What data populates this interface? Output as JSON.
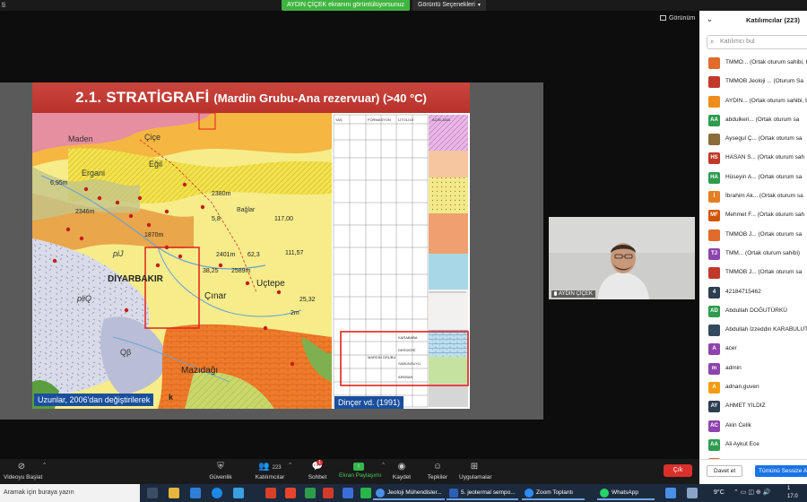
{
  "topbar": {
    "left_mark": "ti",
    "share_banner": "AYDIN ÇİÇEK ekranını görüntülüyorsunuz",
    "view_options": "Görüntü Seçenekleri"
  },
  "stage": {
    "view_button": "Görünüm"
  },
  "slide": {
    "title": "2.1. STRATİGRAFİ",
    "subtitle": "(Mardin Grubu-Ana rezervuar) (>40 °C)",
    "caption_left": "Uzunlar, 2006'dan değiştirilerek",
    "caption_right": "Dinçer vd. (1991)",
    "map_labels": [
      "Maden",
      "Çiçe",
      "Ergani",
      "Eğil",
      "DİYARBAKIR",
      "Uçtepe",
      "Çınar",
      "Mazıdağı",
      "Bağlar",
      "pliQ",
      "piJ",
      "Qβ",
      "k"
    ],
    "map_values": [
      "6,95m",
      "2346m",
      "1870m",
      "2380m",
      "2401m",
      "62,3",
      "111,57",
      "38,25",
      "2589m",
      "117,00",
      "2m",
      "25,32",
      "5,8"
    ],
    "strat_labels": [
      "YAŞ",
      "FORMASYON",
      "LİTOLOJİ",
      "AÇIKLAMA",
      "KARABABA",
      "DERDERE",
      "SABUNSUYU",
      "AREBAN",
      "MARDİN GRUBU"
    ]
  },
  "video": {
    "name": "AYDIN ÇİÇEK"
  },
  "toolbar": {
    "start_video": "Videoyu Başlat",
    "security": "Güvenlik",
    "participants": "Katılımcılar",
    "participants_count": "223",
    "chat": "Sohbet",
    "chat_badge": "1",
    "share_screen": "Ekran Paylaşımı",
    "record": "Kaydet",
    "reactions": "Tepkiler",
    "apps": "Uygulamalar",
    "leave": "Çık"
  },
  "sidebar": {
    "title": "Katılımcılar (223)",
    "search_placeholder": "Katılımcı bul",
    "participants": [
      {
        "initials": "",
        "name": "TMMO... (Ortak oturum sahibi, bu",
        "color": "#e06b2b"
      },
      {
        "initials": "",
        "name": "TMMOB Jeoloji ... (Oturum Sa",
        "color": "#c0392b"
      },
      {
        "initials": "",
        "name": "AYDIN... (Ortak oturum sahibi, b",
        "color": "#f08c1a"
      },
      {
        "initials": "AA",
        "name": "abdulkeri... (Ortak oturum sa",
        "color": "#2e9b4f"
      },
      {
        "initials": "",
        "name": "Aysegul Ç... (Ortak oturum sa",
        "color": "#8a6d3b"
      },
      {
        "initials": "HS",
        "name": "HASAN S... (Ortak oturum sah",
        "color": "#c0392b"
      },
      {
        "initials": "HA",
        "name": "Hüseyin A... (Ortak oturum sa",
        "color": "#2e9b4f"
      },
      {
        "initials": "İ",
        "name": "İbrahim Ak... (Ortak oturum sa",
        "color": "#e67e22"
      },
      {
        "initials": "MF",
        "name": "Mehmet F... (Ortak oturum sah",
        "color": "#d35400"
      },
      {
        "initials": "",
        "name": "TMMOB J... (Ortak oturum sa",
        "color": "#e06b2b"
      },
      {
        "initials": "TJ",
        "name": "TMM... (Ortak oturum sahibi)",
        "color": "#8e44ad"
      },
      {
        "initials": "",
        "name": "TMMOB J... (Ortak oturum sa",
        "color": "#c0392b"
      },
      {
        "initials": "4",
        "name": "42184715462",
        "color": "#2c3e50"
      },
      {
        "initials": "AD",
        "name": "Abdullah DOĞUTÜRKÜ",
        "color": "#2e9b4f"
      },
      {
        "initials": "",
        "name": "Abdullah İzzeddin KARABULUT",
        "color": "#34495e"
      },
      {
        "initials": "A",
        "name": "acer",
        "color": "#8e44ad"
      },
      {
        "initials": "m",
        "name": "admin",
        "color": "#8e44ad"
      },
      {
        "initials": "A",
        "name": "adnan.guven",
        "color": "#f39c12"
      },
      {
        "initials": "AY",
        "name": "AHMET YILDIZ",
        "color": "#2c3e50"
      },
      {
        "initials": "AC",
        "name": "Akin Celik",
        "color": "#8e44ad"
      },
      {
        "initials": "AA",
        "name": "Ali Aykut Ece",
        "color": "#2e9b4f"
      },
      {
        "initials": "",
        "name": "",
        "color": "#e06b2b"
      }
    ],
    "invite": "Davet et",
    "mute_all": "Tümünü Sessize Al"
  },
  "taskbar": {
    "search_placeholder": "Aramak için buraya yazın",
    "apps": [
      {
        "label": "Jeoloji Mühendisler...",
        "color": "#4a8fe7"
      },
      {
        "label": "5. jeotermal sempo...",
        "color": "#2b5fb4"
      },
      {
        "label": "Zoom Toplantı",
        "color": "#2d8cff"
      },
      {
        "label": "WhatsApp",
        "color": "#25d366"
      }
    ],
    "weather": "9°C",
    "clock_time": "1",
    "clock_date": "17.0"
  }
}
